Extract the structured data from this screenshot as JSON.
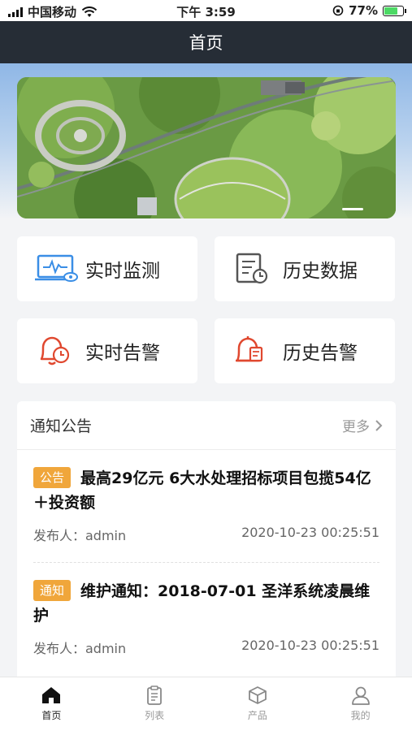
{
  "status_bar": {
    "carrier": "中国移动",
    "time": "下午 3:59",
    "battery": "77%",
    "battery_level": 0.77
  },
  "navbar": {
    "title": "首页"
  },
  "tiles": [
    {
      "label": "实时监测",
      "icon": "monitor-pulse-icon",
      "color": "#3a8ee6"
    },
    {
      "label": "历史数据",
      "icon": "document-clock-icon",
      "color": "#555555"
    },
    {
      "label": "实时告警",
      "icon": "bell-clock-icon",
      "color": "#e0482f"
    },
    {
      "label": "历史告警",
      "icon": "bell-document-icon",
      "color": "#e0482f"
    }
  ],
  "notice": {
    "title": "通知公告",
    "more": "更多",
    "items": [
      {
        "tag": "公告",
        "title": "最高29亿元 6大水处理招标项目包揽54亿＋投资额",
        "publisher": "发布人：admin",
        "time": "2020-10-23 00:25:51"
      },
      {
        "tag": "通知",
        "title": "维护通知：2018-07-01 圣洋系统凌晨维护",
        "publisher": "发布人：admin",
        "time": "2020-10-23 00:25:51"
      }
    ]
  },
  "tabbar": [
    {
      "label": "首页",
      "icon": "home-icon",
      "active": true
    },
    {
      "label": "列表",
      "icon": "clipboard-list-icon",
      "active": false
    },
    {
      "label": "产品",
      "icon": "cube-icon",
      "active": false
    },
    {
      "label": "我的",
      "icon": "user-icon",
      "active": false
    }
  ]
}
